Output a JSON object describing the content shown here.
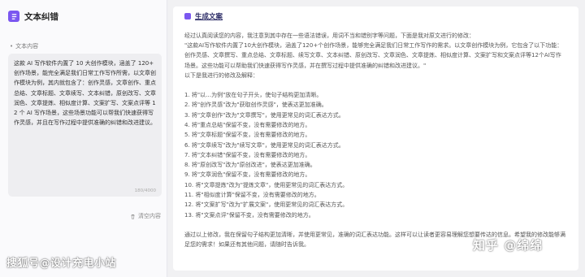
{
  "app": {
    "title": "文本纠错"
  },
  "input": {
    "section_label": "文本内容",
    "text": "这款 AI 写作软件内置了 10 大创作模块，涵盖了 120+ 创作场景，能完全满足我们日常工作写作所需，以文章创作模块为例，其内就包含了：创作灵感，文章创作、重点总结、文章标题、文章续写、文本纠错，原创改写、文章润色、文章提炼、相似度计算、文案扩写、文案点评等 12 个 AI 写作场景，这些场景功能可以帮我们快速获得写作灵感，并且在写作过程中提供准确的纠错和改进建议。",
    "counter": "180/4000"
  },
  "clear": {
    "label": "清空内容"
  },
  "result": {
    "title": "生成文案",
    "intro": "经过认真阅读您的内容，我注意到其中存在一些语法错误，用词不当和错别字等问题，下面是我对原文进行的修改：",
    "revised": "\"这款AI写作软件内置了10大创作模块，涵盖了120+个创作场景，能够完全满足我们日常工作写作的需求。以文章创作模块为例，它包含了以下功能：创作灵感、文章撰写、重点总结、文章标题、续写文章、文本纠错、原创改写、文章润色、文章提炼、相似度计算、文案扩写和文案点评等12个AI写作场景。这些功能可以帮助我们快速获得写作灵感，并在撰写过程中提供准确的纠错和改进建议。\"",
    "list_intro": "以下是我进行的修改及解释：",
    "items": [
      "1. 将\"以…为例\"放在句子开头，使句子结构更加清晰。",
      "2. 将\"创作灵感\"改为\"获取创作灵感\"，使表达更加准确。",
      "3. 将\"文章创作\"改为\"文章撰写\"，使用更常见的词汇表达方式。",
      "4. 将\"重点总结\"保留不变，没有需要修改的地方。",
      "5. 将\"文章标题\"保留不变，没有需要修改的地方。",
      "6. 将\"文章续写\"改为\"续写文章\"，使用更常见的词汇表达方式。",
      "7. 将\"文本纠错\"保留不变，没有需要修改的地方。",
      "8. 将\"原创改写\"改为\"原创改进\"，使表达更加准确。",
      "9. 将\"文章润色\"保留不变，没有需要修改的地方。",
      "10. 将\"文章提炼\"改为\"提炼文章\"，使用更常见的词汇表达方式。",
      "11. 将\"相似度计算\"保留不变，没有需要修改的地方。",
      "12. 将\"文案扩写\"改为\"扩展文案\"，使用更常见的词汇表达方式。",
      "13. 将\"文案点评\"保留不变，没有需要修改的地方。"
    ],
    "conclusion": "通过以上修改，我在保留句子结构更加清晰，并使用更常见，准确的词汇表达功能。这样可以让读者更容易理解您想要传达的信息。希望我的修改能够满足您的需求！如果还有其他问题，请随时告诉我。"
  },
  "watermarks": {
    "left": "搜狐号@设计充电小站",
    "right": "知乎 @绵绵"
  },
  "colors": {
    "accent": "#7b57f0",
    "title": "#2b2b66"
  }
}
